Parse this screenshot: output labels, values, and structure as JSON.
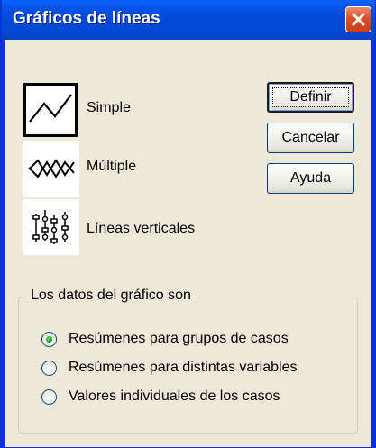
{
  "window": {
    "title": "Gráficos de líneas"
  },
  "chart_types": [
    {
      "label": "Simple",
      "selected": true,
      "icon": "simple-line-chart-icon"
    },
    {
      "label": "Múltiple",
      "selected": false,
      "icon": "multiple-line-chart-icon"
    },
    {
      "label": "Líneas verticales",
      "selected": false,
      "icon": "drop-line-chart-icon"
    }
  ],
  "buttons": {
    "define": "Definir",
    "cancel": "Cancelar",
    "help": "Ayuda"
  },
  "data_group": {
    "legend": "Los datos del gráfico son",
    "options": [
      {
        "label": "Resúmenes para grupos de casos",
        "checked": true
      },
      {
        "label": "Resúmenes para distintas variables",
        "checked": false
      },
      {
        "label": "Valores individuales de los casos",
        "checked": false
      }
    ]
  }
}
